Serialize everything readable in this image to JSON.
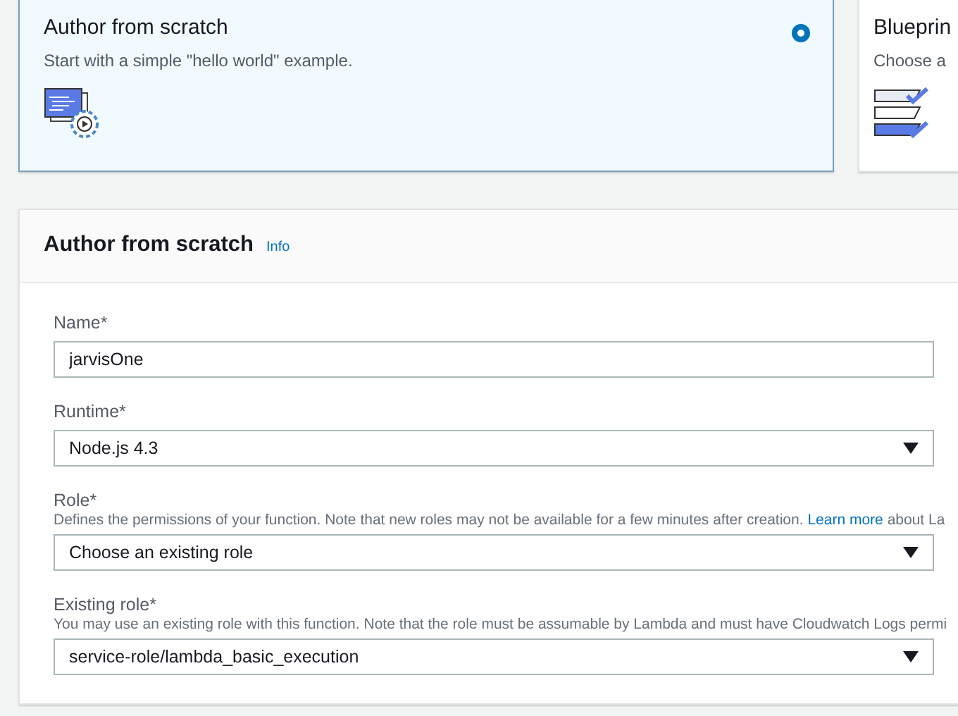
{
  "options": [
    {
      "title": "Author from scratch",
      "description": "Start with a simple \"hello world\" example.",
      "kind": "code",
      "selected": true
    },
    {
      "title": "Blueprin",
      "description": "Choose a",
      "kind": "list",
      "selected": false
    }
  ],
  "panel": {
    "title": "Author from scratch",
    "info": "Info",
    "fields": [
      {
        "kind": "input",
        "label": "Name*",
        "value": "jarvisOne"
      },
      {
        "kind": "select",
        "label": "Runtime*",
        "value": "Node.js 4.3"
      },
      {
        "kind": "select",
        "label": "Role*",
        "help": "Defines the permissions of your function. Note that new roles may not be available for a few minutes after creation.",
        "help_link": "Learn more",
        "help_after": "about La",
        "value": "Choose an existing role"
      },
      {
        "kind": "select",
        "label": "Existing role*",
        "help": "You may use an existing role with this function. Note that the role must be assumable by Lambda and must have Cloudwatch Logs permi",
        "value": "service-role/lambda_basic_execution"
      }
    ]
  }
}
